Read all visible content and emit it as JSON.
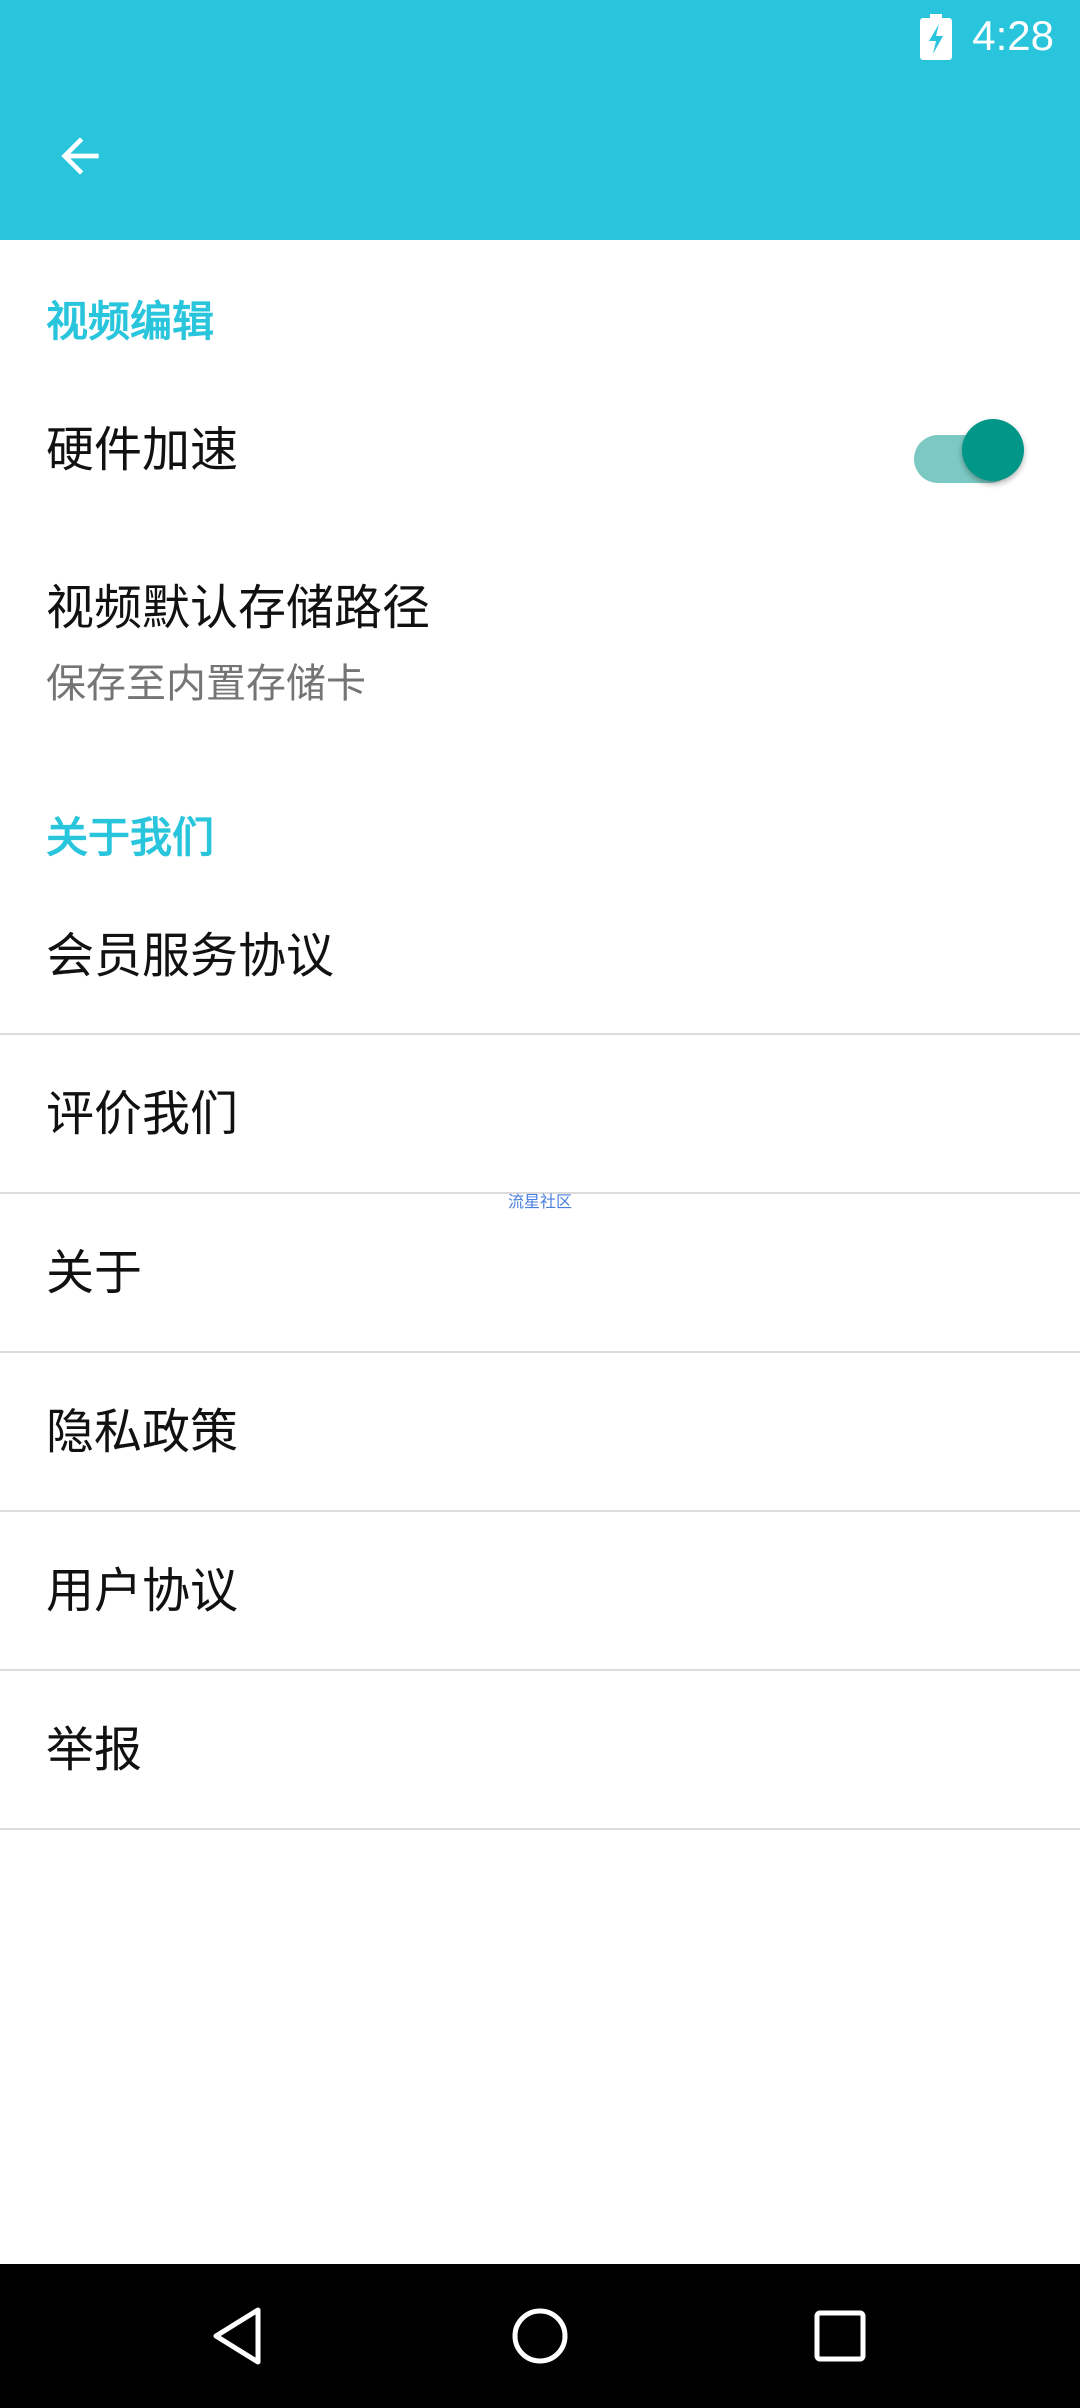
{
  "status_bar": {
    "time": "4:28"
  },
  "colors": {
    "accent": "#29C5DC",
    "switch_on_thumb": "#009688",
    "switch_on_track": "#7CC9C3",
    "nav_bar": "#000000"
  },
  "sections": {
    "video_edit": {
      "header": "视频编辑",
      "hardware_accel": {
        "title": "硬件加速",
        "enabled": true
      },
      "storage_path": {
        "title": "视频默认存储路径",
        "summary": "保存至内置存储卡"
      }
    },
    "about_us": {
      "header": "关于我们",
      "items": [
        {
          "label": "会员服务协议"
        },
        {
          "label": "评价我们"
        },
        {
          "label": "关于"
        },
        {
          "label": "隐私政策"
        },
        {
          "label": "用户协议"
        },
        {
          "label": "举报"
        }
      ]
    }
  },
  "watermark": "流星社区",
  "icons": {
    "back": "arrow-left-icon",
    "battery": "battery-charging-icon",
    "nav_back": "triangle-back-icon",
    "nav_home": "circle-home-icon",
    "nav_recents": "square-recents-icon"
  }
}
